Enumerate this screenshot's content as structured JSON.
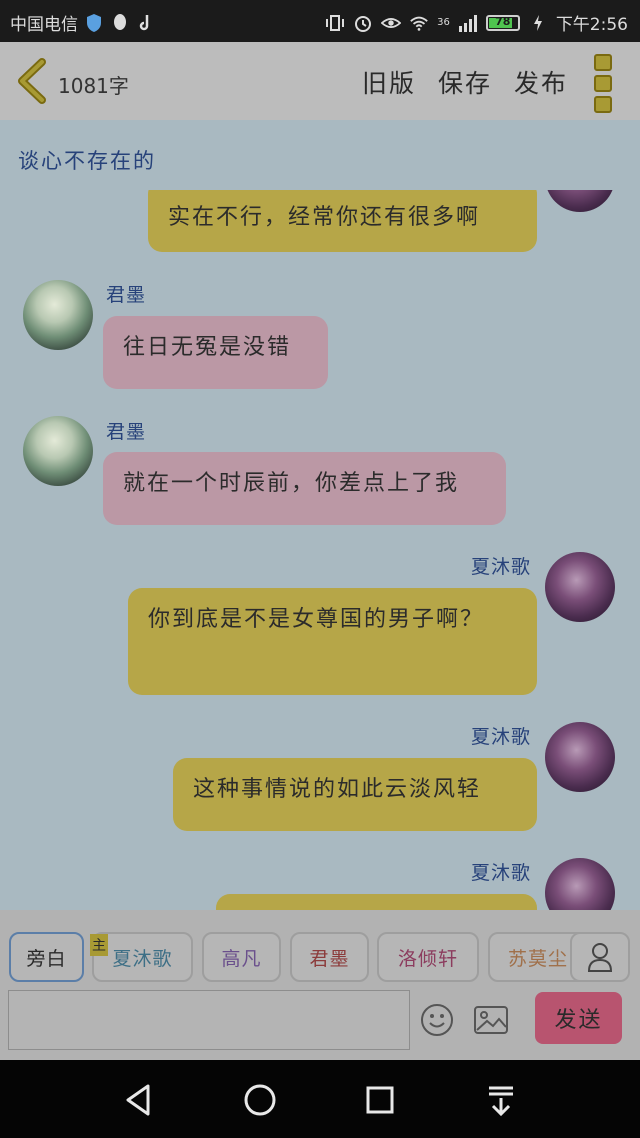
{
  "status_bar": {
    "carrier": "中国电信",
    "network": "36",
    "battery": "78",
    "time": "下午2:56"
  },
  "header": {
    "word_count": "1081字",
    "actions": [
      "旧版",
      "保存",
      "发布"
    ]
  },
  "chat": {
    "title": "谈心不存在的",
    "messages": [
      {
        "side": "right",
        "sender": "",
        "text": "实在不行，经常你还有很多啊",
        "color": "yellow"
      },
      {
        "side": "left",
        "sender": "君墨",
        "text": "往日无冤是没错",
        "color": "pink"
      },
      {
        "side": "left",
        "sender": "君墨",
        "text": "就在一个时辰前，你差点上了我",
        "color": "pink"
      },
      {
        "side": "right",
        "sender": "夏沐歌",
        "text": "你到底是不是女尊国的男子啊？",
        "color": "yellow"
      },
      {
        "side": "right",
        "sender": "夏沐歌",
        "text": "这种事情说的如此云淡风轻",
        "color": "yellow"
      },
      {
        "side": "right",
        "sender": "夏沐歌",
        "text": "",
        "color": "yellow"
      }
    ]
  },
  "characters": {
    "main_badge": "主",
    "items": [
      {
        "label": "旁白",
        "color": "#2a2a2a"
      },
      {
        "label": "夏沐歌",
        "color": "#3d6f86"
      },
      {
        "label": "高凡",
        "color": "#6a4f8c"
      },
      {
        "label": "君墨",
        "color": "#8c3c3c"
      },
      {
        "label": "洛倾轩",
        "color": "#8c3c5e"
      },
      {
        "label": "苏莫尘",
        "color": "#a0704a"
      }
    ]
  },
  "composer": {
    "placeholder": "",
    "send_label": "发送"
  },
  "colors": {
    "accent": "#b8546f",
    "bubble_yellow": "#b6a648",
    "bubble_pink": "#bb98a5",
    "name_blue": "#27427a"
  }
}
